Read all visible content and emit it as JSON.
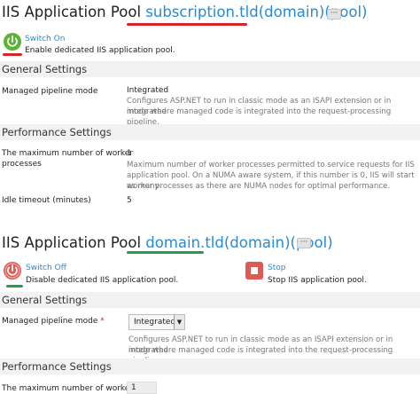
{
  "pool1": {
    "title": "IIS Application Pool",
    "domain": "subscription.tld(domain)(pool)",
    "more": "···",
    "switch_label": "Switch On",
    "switch_desc": "Enable dedicated IIS application pool.",
    "general_header": "General Settings",
    "pipeline_label": "Managed pipeline mode",
    "pipeline_value": "Integrated",
    "pipeline_desc_1": "Configures ASP.NET to run in classic mode as an ISAPI extension or in integrated",
    "pipeline_desc_2": "mode where managed code is integrated into the request-processing pipeline.",
    "performance_header": "Performance Settings",
    "workers_label_1": "The maximum number of worker",
    "workers_label_2": "processes",
    "workers_value": "1",
    "workers_desc_1": "Maximum number of worker processes permitted to service requests for IIS",
    "workers_desc_2": "application pool. On a NUMA aware system, if this number is 0, IIS will start as many",
    "workers_desc_3": "worker processes as there are NUMA nodes for optimal performance.",
    "idle_label": "Idle timeout (minutes)",
    "idle_value": "5"
  },
  "pool2": {
    "title": "IIS Application Pool",
    "domain": "domain.tld(domain)(pool)",
    "more": "···",
    "switch_label": "Switch Off",
    "switch_desc": "Disable dedicated IIS application pool.",
    "stop_label": "Stop",
    "stop_desc": "Stop IIS application pool.",
    "general_header": "General Settings",
    "pipeline_label": "Managed pipeline mode",
    "required_mark": "*",
    "pipeline_select": "Integrated",
    "pipeline_desc_1": "Configures ASP.NET to run in classic mode as an ISAPI extension or in integrated",
    "pipeline_desc_2": "mode where managed code is integrated into the request-processing pipeline.",
    "performance_header": "Performance Settings",
    "workers_label": "The maximum number of worker",
    "workers_value": "1"
  },
  "colors": {
    "link": "#2a8ad4",
    "red_underline": "#d8232a",
    "green_underline": "#21a04a",
    "switch_on_green": "#5cb338",
    "switch_off_red": "#e05a55"
  },
  "icons": [
    "power-on-icon",
    "power-off-icon",
    "stop-icon",
    "dropdown-arrow-icon",
    "more-icon"
  ]
}
